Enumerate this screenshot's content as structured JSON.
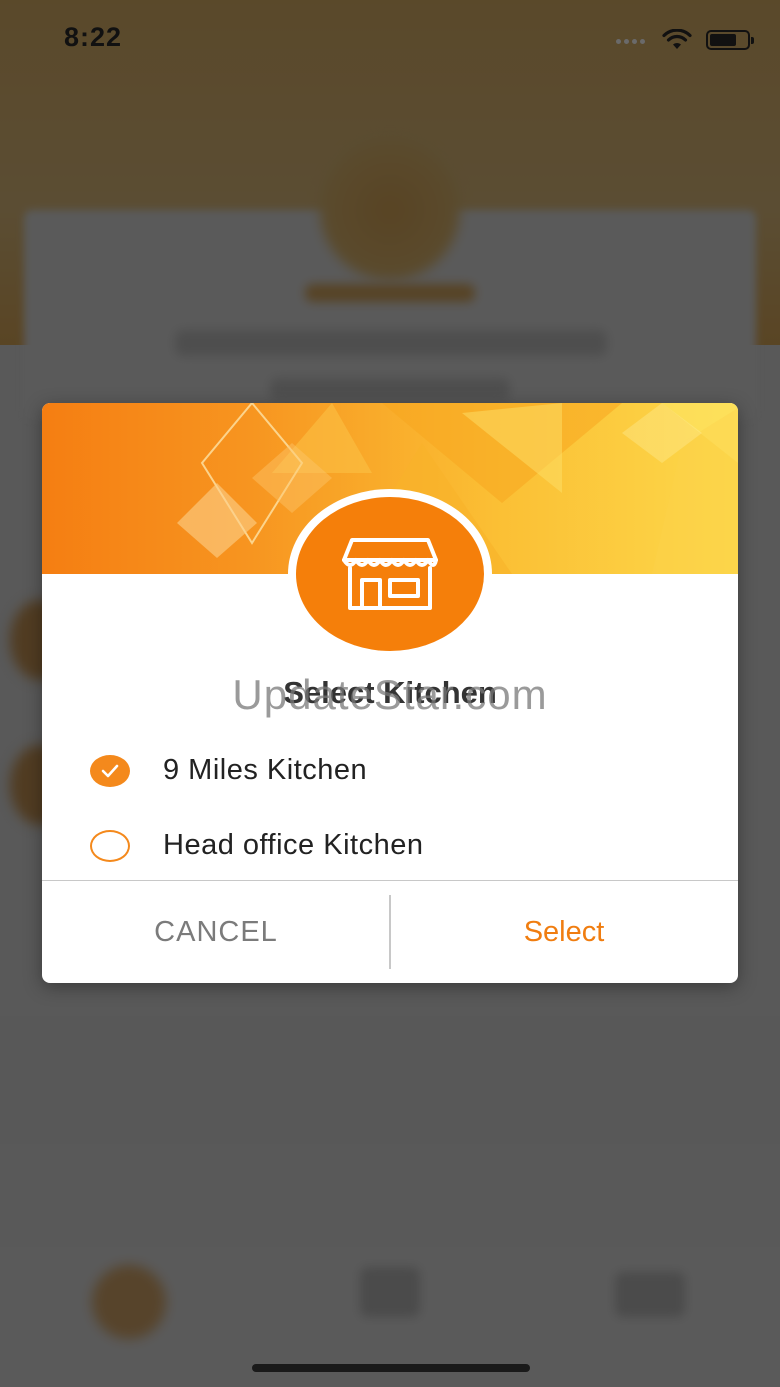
{
  "status_bar": {
    "time": "8:22",
    "icons": [
      "signal-dots-icon",
      "wifi-icon",
      "battery-icon"
    ]
  },
  "dialog": {
    "title": "Select Kitchen",
    "header_icon": "store-icon",
    "options": [
      {
        "label": "9 Miles Kitchen",
        "selected": true
      },
      {
        "label": "Head office Kitchen",
        "selected": false
      }
    ],
    "cancel_label": "CANCEL",
    "select_label": "Select"
  },
  "watermark": "UpdateStar.com",
  "colors": {
    "accent": "#f4891c",
    "select_text": "#f07d10",
    "cancel_text": "#7b7b7b",
    "overlay": "#4a4a4a"
  }
}
